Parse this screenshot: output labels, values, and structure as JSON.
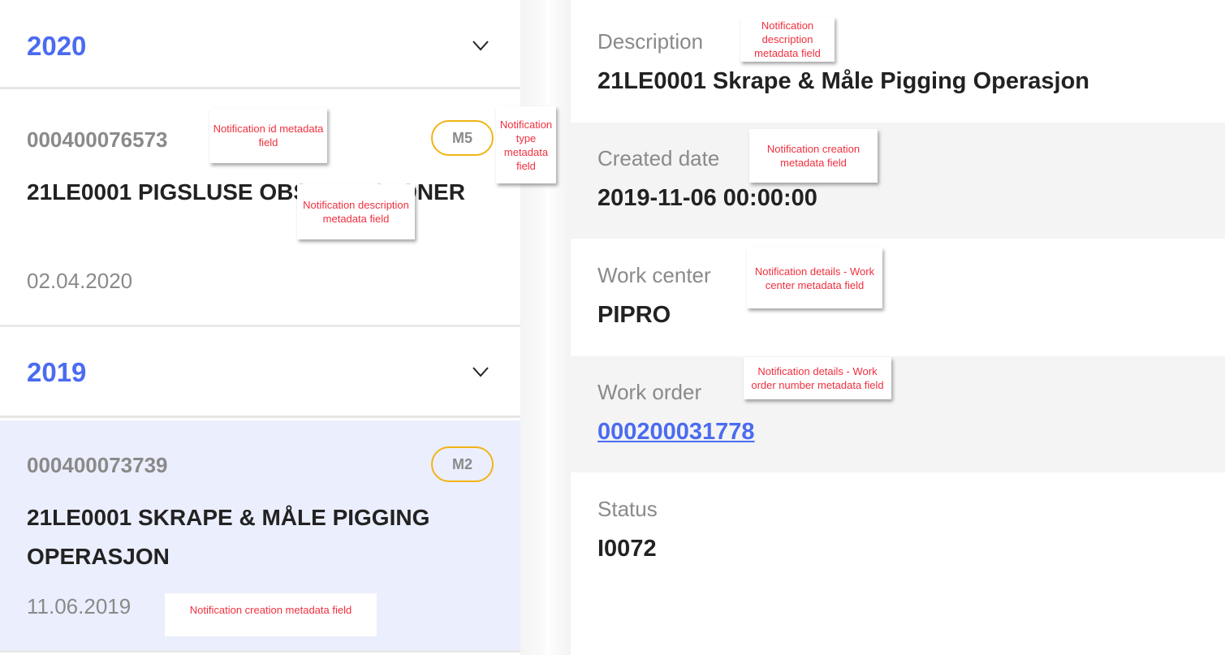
{
  "notification_list": {
    "groups": [
      {
        "year": "2020",
        "notifications": [
          {
            "id": "000400076573",
            "type": "M5",
            "description": "21LE0001 PIGSLUSE OBSTRUKSJONER",
            "date": "02.04.2020",
            "selected": false
          }
        ]
      },
      {
        "year": "2019",
        "notifications": [
          {
            "id": "000400073739",
            "type": "M2",
            "description": "21LE0001 SKRAPE & MÅLE PIGGING OPERASJON",
            "date": "11.06.2019",
            "selected": true
          }
        ]
      }
    ]
  },
  "details": {
    "fields": [
      {
        "label": "Description",
        "value": "21LE0001 Skrape & Måle Pigging Operasjon"
      },
      {
        "label": "Created date",
        "value": "2019-11-06 00:00:00"
      },
      {
        "label": "Work center",
        "value": "PIPRO"
      },
      {
        "label": "Work order",
        "value": "000200031778",
        "is_link": true
      },
      {
        "label": "Status",
        "value": "I0072"
      }
    ]
  },
  "annotations": {
    "notification_id": "Notification id metadata field",
    "notification_type": "Notification type metadata field",
    "list_description": "Notification description metadata field",
    "list_creation": "Notification creation metadata field",
    "detail_description": "Notification description metadata field",
    "detail_creation": "Notification creation metadata field",
    "detail_work_center": "Notification details - Work center metadata field",
    "detail_work_order": "Notification details - Work order number metadata field"
  },
  "colors": {
    "accent": "#4b6bf0",
    "badge_border": "#f2b416",
    "selected_bg": "#ebeefc",
    "annotation_text": "#f0303e"
  }
}
